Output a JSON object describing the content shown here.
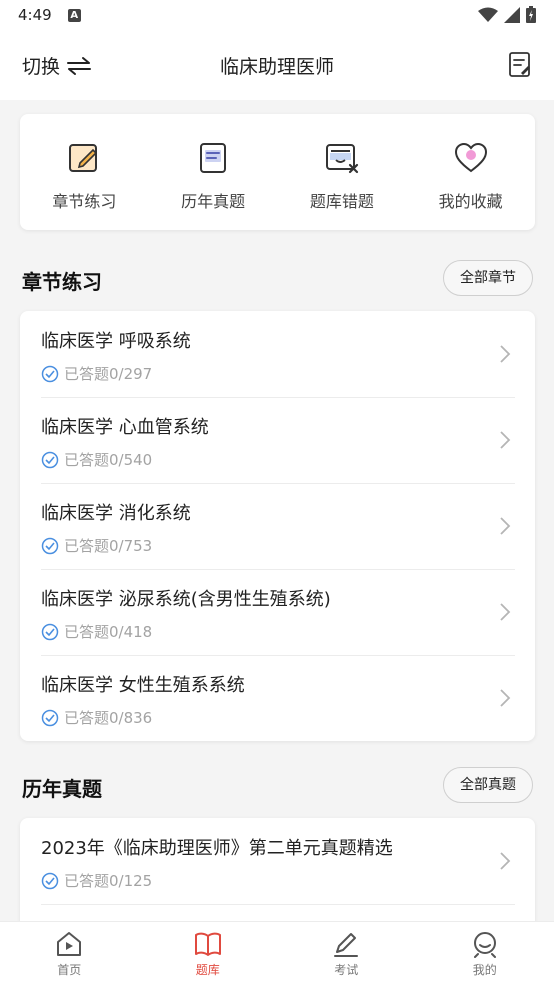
{
  "status_bar": {
    "time": "4:49",
    "notification_icon_letter": "A"
  },
  "header": {
    "switch_label": "切换",
    "title": "临床助理医师"
  },
  "quick_actions": [
    {
      "label": "章节练习",
      "icon": "edit-note-icon"
    },
    {
      "label": "历年真题",
      "icon": "document-icon"
    },
    {
      "label": "题库错题",
      "icon": "wrong-questions-icon"
    },
    {
      "label": "我的收藏",
      "icon": "heart-icon"
    }
  ],
  "chapter_section": {
    "title": "章节练习",
    "all_button": "全部章节",
    "items": [
      {
        "title": "临床医学 呼吸系统",
        "status": "已答题0/297"
      },
      {
        "title": "临床医学 心血管系统",
        "status": "已答题0/540"
      },
      {
        "title": "临床医学 消化系统",
        "status": "已答题0/753"
      },
      {
        "title": "临床医学 泌尿系统(含男性生殖系统)",
        "status": "已答题0/418"
      },
      {
        "title": "临床医学 女性生殖系系统",
        "status": "已答题0/836"
      }
    ]
  },
  "past_exam_section": {
    "title": "历年真题",
    "all_button": "全部真题",
    "items": [
      {
        "title": "2023年《临床助理医师》第二单元真题精选",
        "status": "已答题0/125"
      }
    ]
  },
  "tabbar": [
    {
      "label": "首页",
      "icon": "home-play-icon",
      "active": false
    },
    {
      "label": "题库",
      "icon": "book-icon",
      "active": true
    },
    {
      "label": "考试",
      "icon": "pen-icon",
      "active": false
    },
    {
      "label": "我的",
      "icon": "profile-icon",
      "active": false
    }
  ],
  "colors": {
    "accent": "#e04a3f",
    "check": "#4a8fe0",
    "background": "#f4f4f4"
  }
}
